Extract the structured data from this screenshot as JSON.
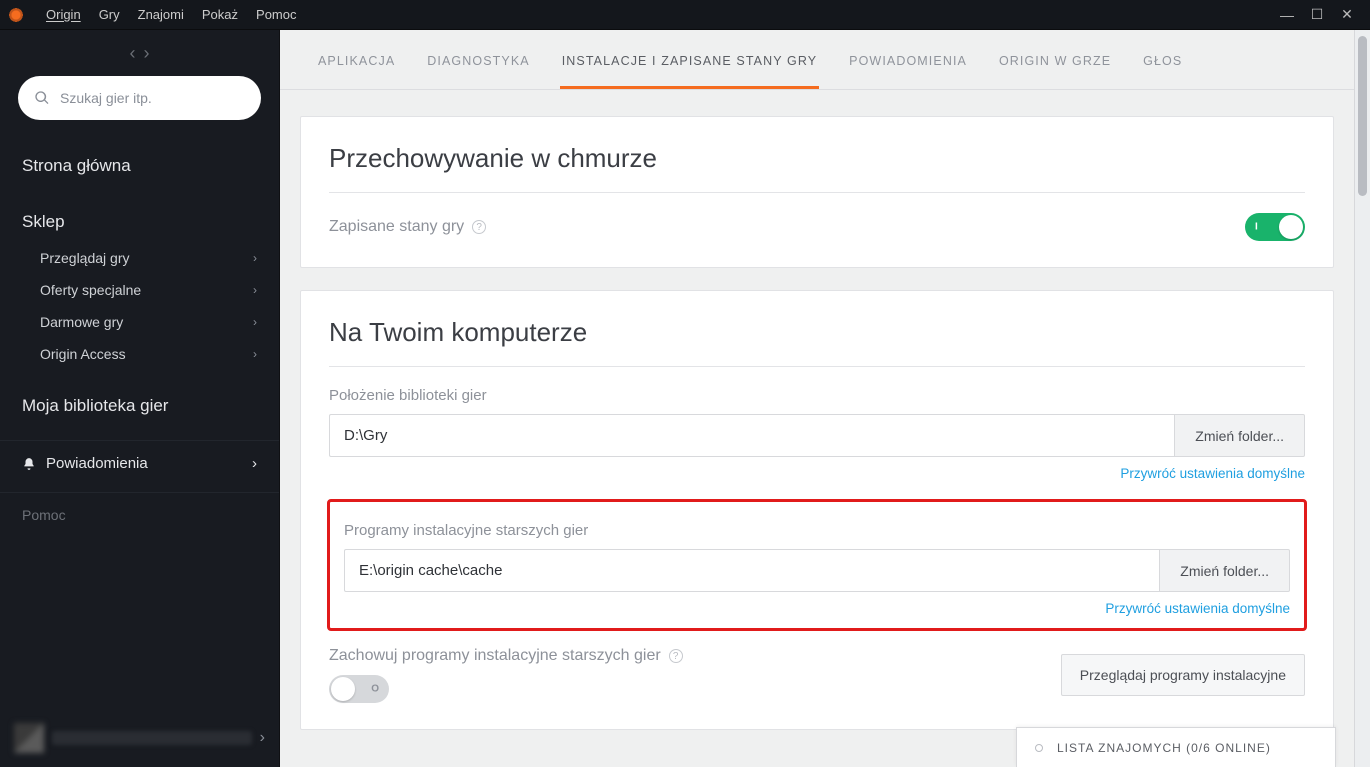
{
  "titlebar": {
    "menu": [
      "Origin",
      "Gry",
      "Znajomi",
      "Pokaż",
      "Pomoc"
    ]
  },
  "sidebar": {
    "search_placeholder": "Szukaj gier itp.",
    "items": {
      "home": "Strona główna",
      "store": "Sklep",
      "store_sub": [
        "Przeglądaj gry",
        "Oferty specjalne",
        "Darmowe gry",
        "Origin Access"
      ],
      "library": "Moja biblioteka gier",
      "notifications": "Powiadomienia",
      "help": "Pomoc"
    }
  },
  "tabs": [
    "APLIKACJA",
    "DIAGNOSTYKA",
    "INSTALACJE I ZAPISANE STANY GRY",
    "POWIADOMIENIA",
    "ORIGIN W GRZE",
    "GŁOS"
  ],
  "active_tab_index": 2,
  "cloud": {
    "title": "Przechowywanie w chmurze",
    "saves_label": "Zapisane stany gry",
    "saves_toggle_on": true,
    "toggle_on_text": "I"
  },
  "local": {
    "title": "Na Twoim komputerze",
    "library_label": "Położenie biblioteki gier",
    "library_path": "D:\\Gry",
    "change_folder": "Zmień folder...",
    "restore": "Przywróć ustawienia domyślne",
    "legacy_label": "Programy instalacyjne starszych gier",
    "legacy_path": "E:\\origin cache\\cache",
    "keep_label": "Zachowuj programy instalacyjne starszych gier",
    "keep_toggle_on": false,
    "toggle_off_text": "O",
    "browse_installers": "Przeglądaj programy instalacyjne"
  },
  "friends": {
    "label": "LISTA ZNAJOMYCH (0/6 ONLINE)"
  }
}
